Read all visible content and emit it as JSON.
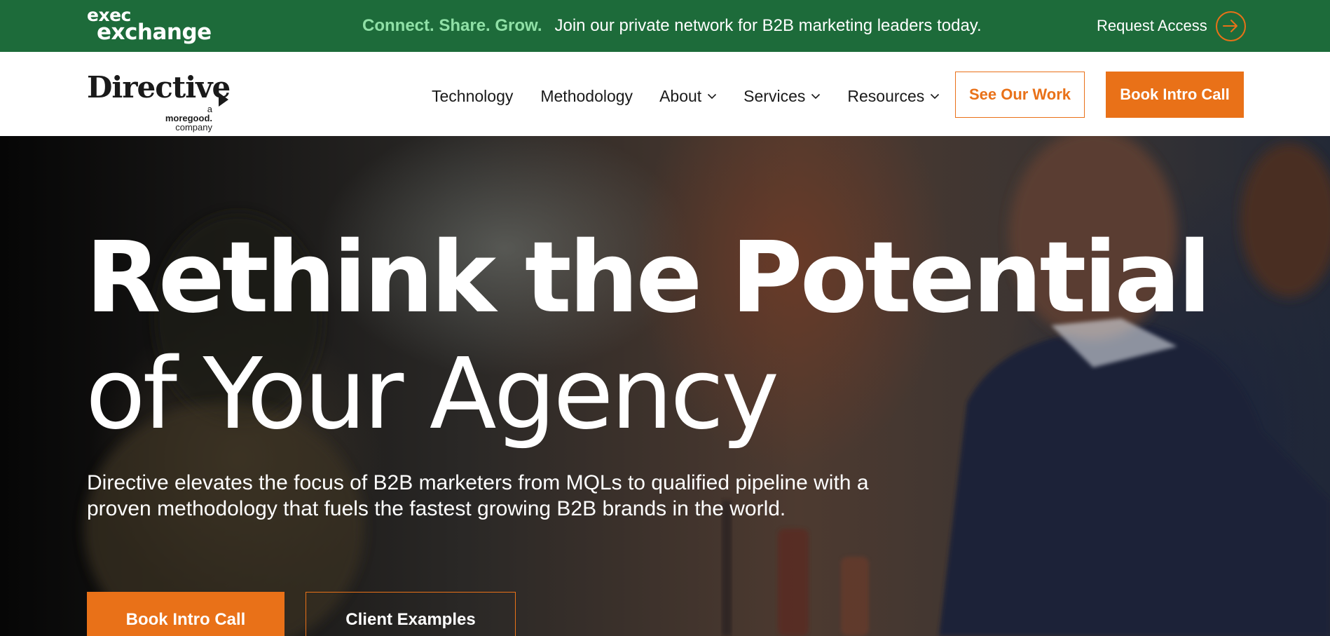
{
  "topbar": {
    "logo_line1": "exec",
    "logo_line2": "exchange",
    "tagline": "Connect. Share. Grow.",
    "message": "Join our private network for B2B marketing leaders today.",
    "request_access_label": "Request Access",
    "request_access_icon": "arrow-right-circle-icon",
    "background_color": "#1d6b3a",
    "tagline_color": "#8fe0a6"
  },
  "nav": {
    "brand_wordmark": "Directive",
    "brand_sub_prefix": "a",
    "brand_sub_name": "moregood.",
    "brand_sub_suffix": "company",
    "items": [
      {
        "label": "Technology",
        "has_dropdown": false
      },
      {
        "label": "Methodology",
        "has_dropdown": false
      },
      {
        "label": "About",
        "has_dropdown": true
      },
      {
        "label": "Services",
        "has_dropdown": true
      },
      {
        "label": "Resources",
        "has_dropdown": true
      }
    ],
    "cta_outline_label": "See Our Work",
    "cta_solid_label": "Book Intro Call",
    "accent_color": "#e97118"
  },
  "hero": {
    "title_line1": "Rethink the Potential",
    "title_line2": "of Your Agency",
    "subtitle_line1": "Directive elevates the focus of B2B marketers from MQLs to qualified pipeline with a",
    "subtitle_line2": "proven methodology that fuels the fastest growing B2B brands in the world.",
    "primary_button_label": "Book Intro Call",
    "secondary_button_label": "Client Examples"
  }
}
